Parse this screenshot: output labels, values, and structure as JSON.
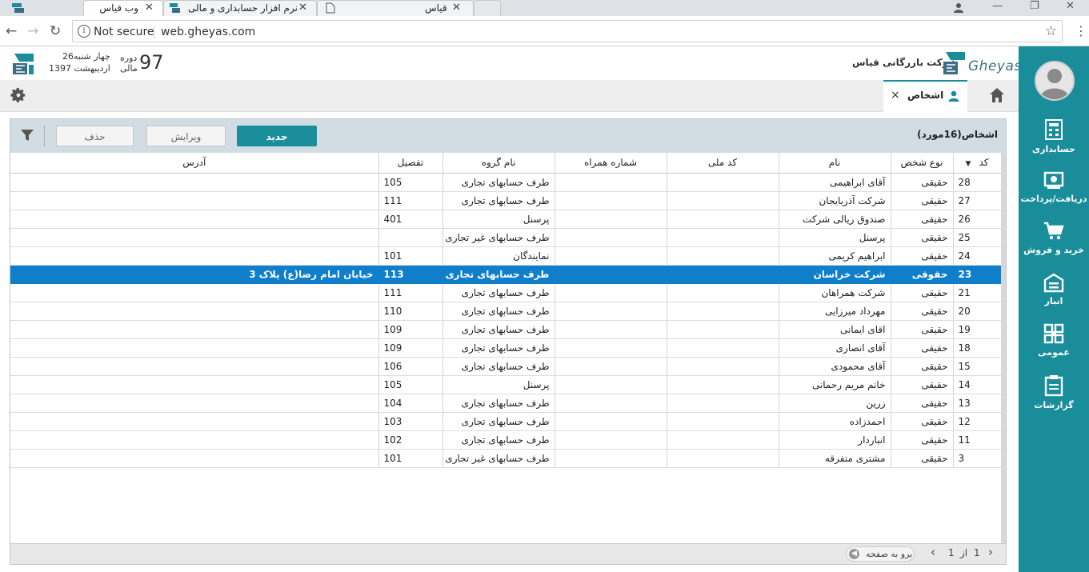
{
  "browser": {
    "tabs": [
      {
        "title": "وب قیاس",
        "active": true
      },
      {
        "title": "نرم افزار حسابداری و مالی",
        "active": false
      },
      {
        "title": "قیاس",
        "active": false
      }
    ],
    "not_secure": "Not secure",
    "url": "web.gheyas.com"
  },
  "header": {
    "period_number": "97",
    "period_label_1": "دوره",
    "period_label_2": "مالی",
    "date_line_1": "چهار شنبه26",
    "date_line_2": "اردیبهشت 1397",
    "company_name": "شرکت بازرگانی قیاس",
    "brand": "Gheyas"
  },
  "page_tab": {
    "label": "اشخاص",
    "close": "×"
  },
  "panel": {
    "title": "اشخاص(16مورد)",
    "buttons": {
      "new": "جدید",
      "edit": "ویرایش",
      "delete": "حذف"
    }
  },
  "grid": {
    "columns": [
      "کد",
      "نوع شخص",
      "نام",
      "کد ملی",
      "شماره همراه",
      "نام گروه",
      "تفصیل",
      "آدرس"
    ],
    "rows": [
      {
        "code": "28",
        "type": "حقیقی",
        "name": "آقای ابراهیمی",
        "national_id": "",
        "mobile": "",
        "group": "طرف حسابهای تجاری",
        "detail": "105",
        "address": ""
      },
      {
        "code": "27",
        "type": "حقیقی",
        "name": "شرکت آذربایجان",
        "national_id": "",
        "mobile": "",
        "group": "طرف حسابهای تجاری",
        "detail": "111",
        "address": ""
      },
      {
        "code": "26",
        "type": "حقیقی",
        "name": "صندوق ریالی شرکت",
        "national_id": "",
        "mobile": "",
        "group": "پرسنل",
        "detail": "401",
        "address": ""
      },
      {
        "code": "25",
        "type": "حقیقی",
        "name": "پرسنل",
        "national_id": "",
        "mobile": "",
        "group": "طرف حسابهای غیر تجاری",
        "detail": "",
        "address": ""
      },
      {
        "code": "24",
        "type": "حقیقی",
        "name": "ابراهیم کریمی",
        "national_id": "",
        "mobile": "",
        "group": "نمایندگان",
        "detail": "101",
        "address": ""
      },
      {
        "code": "23",
        "type": "حقوقی",
        "name": "شرکت خراسان",
        "national_id": "",
        "mobile": "",
        "group": "طرف حسابهای تجاری",
        "detail": "113",
        "address": "خیابان امام رضا(ع) پلاک 3",
        "selected": true
      },
      {
        "code": "21",
        "type": "حقیقی",
        "name": "شرکت همراهان",
        "national_id": "",
        "mobile": "",
        "group": "طرف حسابهای تجاری",
        "detail": "111",
        "address": ""
      },
      {
        "code": "20",
        "type": "حقیقی",
        "name": "مهرداد میرزایی",
        "national_id": "",
        "mobile": "",
        "group": "طرف حسابهای تجاری",
        "detail": "110",
        "address": ""
      },
      {
        "code": "19",
        "type": "حقیقی",
        "name": "اقای ایمانی",
        "national_id": "",
        "mobile": "",
        "group": "طرف حسابهای تجاری",
        "detail": "109",
        "address": ""
      },
      {
        "code": "18",
        "type": "حقیقی",
        "name": "آقای انصاری",
        "national_id": "",
        "mobile": "",
        "group": "طرف حسابهای تجاری",
        "detail": "109",
        "address": ""
      },
      {
        "code": "15",
        "type": "حقیقی",
        "name": "آقای محمودی",
        "national_id": "",
        "mobile": "",
        "group": "طرف حسابهای تجاری",
        "detail": "106",
        "address": ""
      },
      {
        "code": "14",
        "type": "حقیقی",
        "name": "خانم مریم رحمانی",
        "national_id": "",
        "mobile": "",
        "group": "پرسنل",
        "detail": "105",
        "address": ""
      },
      {
        "code": "13",
        "type": "حقیقی",
        "name": "زرین",
        "national_id": "",
        "mobile": "",
        "group": "طرف حسابهای تجاری",
        "detail": "104",
        "address": ""
      },
      {
        "code": "12",
        "type": "حقیقی",
        "name": "احمدزاده",
        "national_id": "",
        "mobile": "",
        "group": "طرف حسابهای تجاری",
        "detail": "103",
        "address": ""
      },
      {
        "code": "11",
        "type": "حقیقی",
        "name": "انباردار",
        "national_id": "",
        "mobile": "",
        "group": "طرف حسابهای تجاری",
        "detail": "102",
        "address": ""
      },
      {
        "code": "3",
        "type": "حقیقی",
        "name": "مشتری متفرقه",
        "national_id": "",
        "mobile": "",
        "group": "طرف حسابهای غیر تجاری",
        "detail": "101",
        "address": ""
      }
    ]
  },
  "pager": {
    "page": "1",
    "of_label": "از",
    "total": "1",
    "goto_label": "برو به صفحه"
  },
  "sidebar": {
    "items": [
      {
        "label": "حسابداری",
        "icon": "accounting-icon"
      },
      {
        "label": "دریافت/پرداخت",
        "icon": "payment-icon"
      },
      {
        "label": "خرید و فروش",
        "icon": "cart-icon"
      },
      {
        "label": "انبار",
        "icon": "warehouse-icon"
      },
      {
        "label": "عمومی",
        "icon": "general-icon"
      },
      {
        "label": "گزارشات",
        "icon": "reports-icon"
      }
    ]
  },
  "colors": {
    "accent": "#1a8d9a",
    "selected_row": "#0f7ecb",
    "panel_header": "#d2dce3"
  }
}
